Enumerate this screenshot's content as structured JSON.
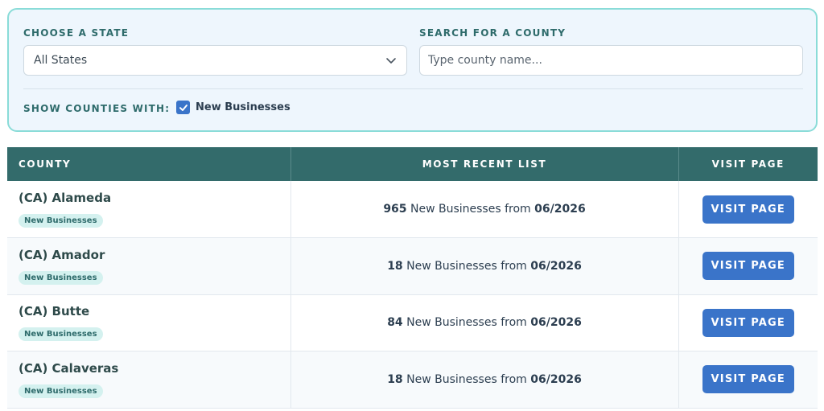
{
  "filters": {
    "state_label": "CHOOSE A STATE",
    "state_value": "All States",
    "search_label": "SEARCH FOR A COUNTY",
    "search_placeholder": "Type county name...",
    "show_label": "SHOW COUNTIES WITH:",
    "checkbox_label": "New Businesses",
    "checkbox_checked": true
  },
  "table": {
    "headers": [
      "COUNTY",
      "MOST RECENT LIST",
      "VISIT PAGE"
    ],
    "rows": [
      {
        "county": "(CA) Alameda",
        "badge": "New Businesses",
        "count": "965",
        "list_text": "New Businesses from",
        "date": "06/2026",
        "button": "VISIT PAGE"
      },
      {
        "county": "(CA) Amador",
        "badge": "New Businesses",
        "count": "18",
        "list_text": "New Businesses from",
        "date": "06/2026",
        "button": "VISIT PAGE"
      },
      {
        "county": "(CA) Butte",
        "badge": "New Businesses",
        "count": "84",
        "list_text": "New Businesses from",
        "date": "06/2026",
        "button": "VISIT PAGE"
      },
      {
        "county": "(CA) Calaveras",
        "badge": "New Businesses",
        "count": "18",
        "list_text": "New Businesses from",
        "date": "06/2026",
        "button": "VISIT PAGE"
      }
    ]
  },
  "colors": {
    "header_bg": "#336b6b",
    "accent_blue": "#3a74c9",
    "panel_bg": "#eef6fd",
    "panel_border": "#8adcd8",
    "badge_bg": "#d4f1ef"
  }
}
